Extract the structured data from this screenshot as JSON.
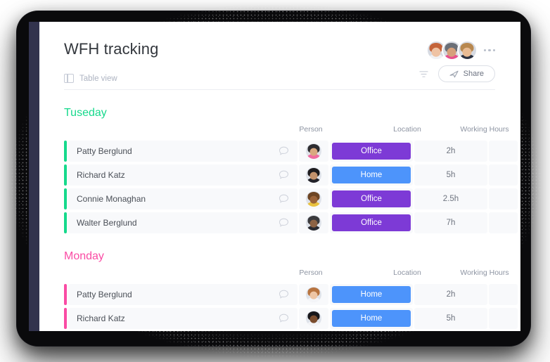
{
  "app": {
    "title": "WFH tracking",
    "view_label": "Table view",
    "view_icon": "table-view-icon",
    "share_label": "Share",
    "share_icon": "send-icon",
    "filter_icon": "filter-icon",
    "more_icon": "more-options-icon",
    "add_column_label": "+"
  },
  "colors": {
    "office_chip": "#7d3ad6",
    "home_chip": "#4d94fb",
    "tuesday_accent": "#16d98c",
    "monday_accent": "#fa4ba4",
    "rail": "#32334d",
    "cell_bg": "#f8f9fb"
  },
  "collaborators": [
    {
      "name": "collaborator-1",
      "hair": "#c4643a",
      "skin": "#efc3a4",
      "body": "#f0f1f4"
    },
    {
      "name": "collaborator-2",
      "hair": "#6b6f77",
      "skin": "#d6a07a",
      "body": "#e8508c"
    },
    {
      "name": "collaborator-3",
      "hair": "#b8884f",
      "skin": "#e8bb93",
      "body": "#2c3240"
    }
  ],
  "columns": [
    "Person",
    "Location",
    "Working Hours"
  ],
  "groups": [
    {
      "title": "Tuseday",
      "accent": "#16d98c",
      "rows": [
        {
          "name": "Patty Berglund",
          "avatar": {
            "hair": "#2d2c30",
            "skin": "#d9a87f",
            "body": "#f06ba0"
          },
          "location": "Office",
          "location_color": "#7d3ad6",
          "hours": "2h"
        },
        {
          "name": "Richard Katz",
          "avatar": {
            "hair": "#1d1b1e",
            "skin": "#c3926c",
            "body": "#23232a"
          },
          "location": "Home",
          "location_color": "#4d94fb",
          "hours": "5h"
        },
        {
          "name": "Connie Monaghan",
          "avatar": {
            "hair": "#6d4523",
            "skin": "#9b6338",
            "body": "#e9c23f"
          },
          "location": "Office",
          "location_color": "#7d3ad6",
          "hours": "2.5h"
        },
        {
          "name": "Walter Berglund",
          "avatar": {
            "hair": "#3a3a3d",
            "skin": "#8d6344",
            "body": "#2a2b31"
          },
          "location": "Office",
          "location_color": "#7d3ad6",
          "hours": "7h"
        }
      ]
    },
    {
      "title": "Monday",
      "accent": "#fa4ba4",
      "rows": [
        {
          "name": "Patty Berglund",
          "avatar": {
            "hair": "#b8743f",
            "skin": "#eec6a5",
            "body": "#f4f5f8"
          },
          "location": "Home",
          "location_color": "#4d94fb",
          "hours": "2h"
        },
        {
          "name": "Richard Katz",
          "avatar": {
            "hair": "#17161a",
            "skin": "#7a4c2e",
            "body": "#f2f3f6"
          },
          "location": "Home",
          "location_color": "#4d94fb",
          "hours": "5h"
        }
      ]
    }
  ]
}
